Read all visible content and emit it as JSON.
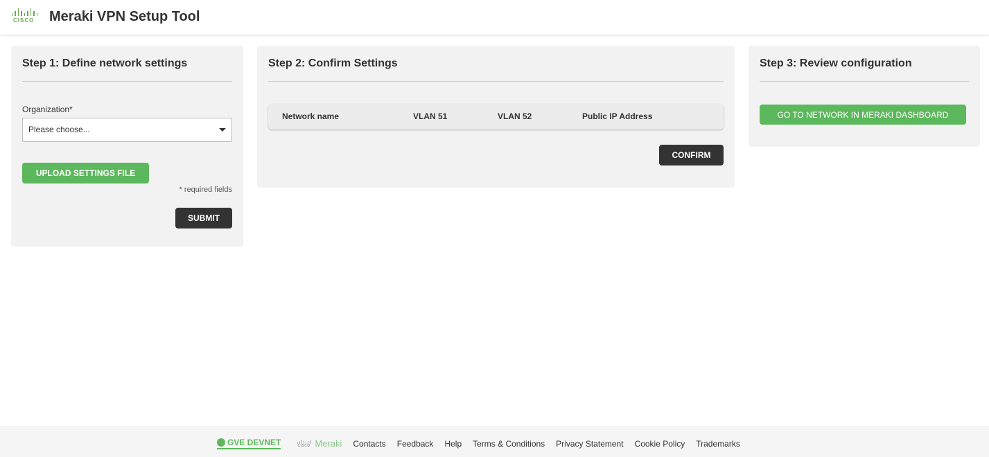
{
  "header": {
    "logo_word": "CISCO",
    "title": "Meraki VPN Setup Tool"
  },
  "step1": {
    "title": "Step 1: Define network settings",
    "org_label": "Organization*",
    "org_select_value": "Please choose...",
    "upload_label": "UPLOAD SETTINGS FILE",
    "required_note": "* required fields",
    "submit_label": "SUBMIT"
  },
  "step2": {
    "title": "Step 2: Confirm Settings",
    "columns": [
      "Network name",
      "VLAN 51",
      "VLAN 52",
      "Public IP Address"
    ],
    "confirm_label": "CONFIRM"
  },
  "step3": {
    "title": "Step 3: Review configuration",
    "dashboard_label": "GO TO NETWORK IN MERAKI DASHBOARD"
  },
  "footer": {
    "devnet_label": "GVE DEVNET",
    "meraki_label": "Meraki",
    "meraki_cisco_word": "CISCO",
    "links": [
      "Contacts",
      "Feedback",
      "Help",
      "Terms & Conditions",
      "Privacy Statement",
      "Cookie Policy",
      "Trademarks"
    ]
  },
  "colors": {
    "accent_green": "#5cb85c",
    "dark_button": "#333333",
    "card_bg": "#f2f2f2"
  }
}
